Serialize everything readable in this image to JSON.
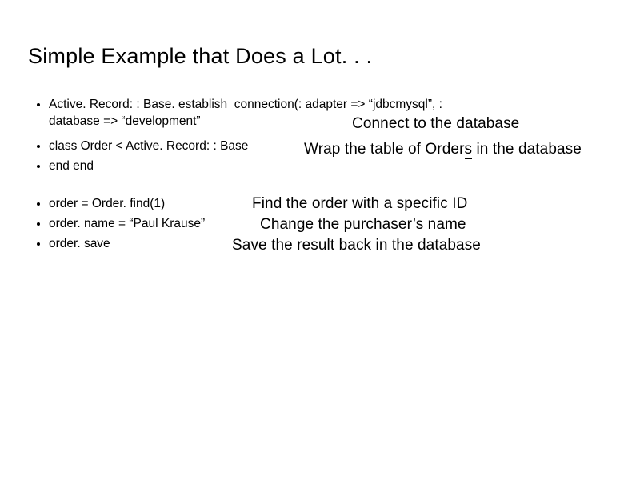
{
  "title": "Simple Example that Does a Lot. . .",
  "bullets": [
    "Active. Record: : Base. establish_connection(: adapter => “jdbcmysql”, : database => “development”",
    "class Order < Active. Record: : Base",
    "end end",
    "order = Order. find(1)",
    "order. name = “Paul Krause”",
    "order. save"
  ],
  "annotations": {
    "connect": "Connect to the database",
    "wrap_prefix": "Wrap the table of Order",
    "wrap_underlined": "s",
    "wrap_suffix": " in the database",
    "find": "Find the order with a specific ID",
    "change": "Change the purchaser’s name",
    "save": "Save the result back in the database"
  }
}
